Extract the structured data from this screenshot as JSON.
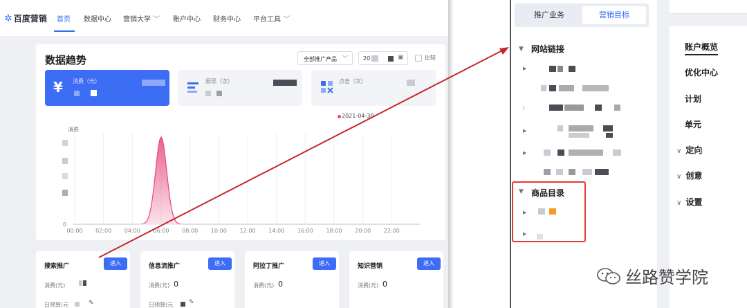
{
  "nav": {
    "logo": "百度营销",
    "items": [
      {
        "label": "首页",
        "active": true
      },
      {
        "label": "数据中心",
        "active": false
      },
      {
        "label": "营销大学",
        "active": false,
        "dropdown": true
      },
      {
        "label": "账户中心",
        "active": false
      },
      {
        "label": "财务中心",
        "active": false
      },
      {
        "label": "平台工具",
        "active": false,
        "dropdown": true
      }
    ]
  },
  "trend": {
    "title": "数据趋势",
    "product_select": "全部推广产品",
    "date_prefix": "20",
    "compare_label": "比较",
    "metrics": [
      {
        "icon": "yuan-icon",
        "label": "消费（元）"
      },
      {
        "icon": "bars-icon",
        "label": "展现（次）"
      },
      {
        "icon": "grid-icon",
        "label": "点击（次）"
      }
    ],
    "legend_date": "2021-04-30",
    "ylabel": "消费"
  },
  "chart_data": {
    "type": "area",
    "x": [
      "00:00",
      "02:00",
      "04:00",
      "06:00",
      "08:00",
      "10:00",
      "12:00",
      "14:00",
      "16:00",
      "18:00",
      "20:00",
      "22:00"
    ],
    "series": [
      {
        "values": [
          0,
          0,
          0,
          1,
          0,
          0,
          0,
          0,
          0,
          0,
          0,
          0
        ]
      }
    ],
    "peak_hour": 6,
    "y_tick_shown": "0",
    "color": "#e8467c"
  },
  "cards": [
    {
      "title": "搜索推广",
      "button": "进入",
      "spend_label": "消费(元)",
      "spend_value": "",
      "budget_label": "日预算(元"
    },
    {
      "title": "信息流推广",
      "button": "进入",
      "spend_label": "消费(元)",
      "spend_value": "0",
      "budget_label": "日预算(元"
    },
    {
      "title": "阿拉丁推广",
      "button": "进入",
      "spend_label": "消费(元)",
      "spend_value": "0",
      "budget_label": ""
    },
    {
      "title": "知识营销",
      "button": "进入",
      "spend_label": "消费(元)",
      "spend_value": "0",
      "budget_label": ""
    }
  ],
  "right_tabs": {
    "tab1": "推广业务",
    "tab2": "营销目标"
  },
  "tree": {
    "section1": "网站链接",
    "section2": "商品目录"
  },
  "right_menu": {
    "items": [
      {
        "label": "账户概览",
        "active": true,
        "chevron": false
      },
      {
        "label": "优化中心",
        "chevron": false
      },
      {
        "label": "计划",
        "chevron": false
      },
      {
        "label": "单元",
        "chevron": false
      },
      {
        "label": "定向",
        "chevron": true
      },
      {
        "label": "创意",
        "chevron": true
      },
      {
        "label": "设置",
        "chevron": true
      }
    ]
  },
  "watermark": "丝路赞学院",
  "colors": {
    "accent": "#3d6cf5",
    "chart": "#e8467c",
    "annotation": "#c62828"
  }
}
